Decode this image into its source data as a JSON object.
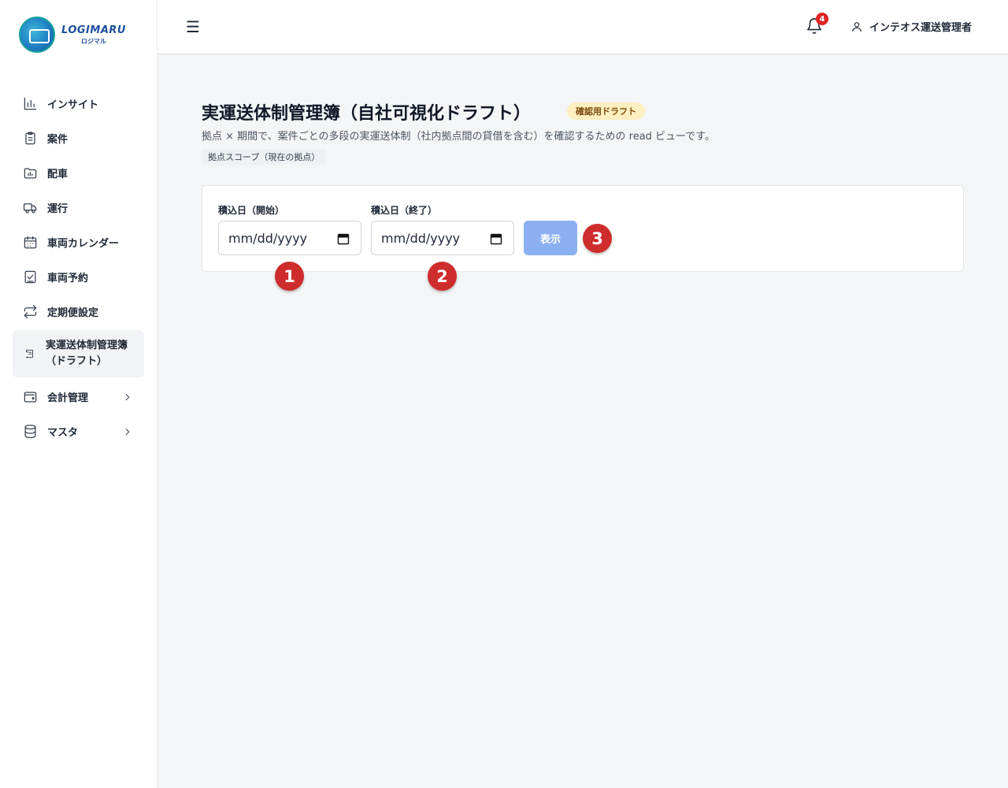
{
  "sidebar": {
    "logo": {
      "main": "LOGIMARU",
      "sub": "ロジマル"
    },
    "items": [
      {
        "label": "インサイト",
        "icon": "bar-chart-icon"
      },
      {
        "label": "案件",
        "icon": "clipboard-icon"
      },
      {
        "label": "配車",
        "icon": "folder-chart-icon"
      },
      {
        "label": "運行",
        "icon": "truck-icon"
      },
      {
        "label": "車両カレンダー",
        "icon": "calendar-icon"
      },
      {
        "label": "車両予約",
        "icon": "clipboard-check-icon"
      },
      {
        "label": "定期便設定",
        "icon": "repeat-icon"
      },
      {
        "label": "実運送体制管理簿\n（ドラフト）",
        "icon": "scroll-icon",
        "active": true
      },
      {
        "label": "会計管理",
        "icon": "wallet-icon",
        "expandable": true
      },
      {
        "label": "マスタ",
        "icon": "database-icon",
        "expandable": true
      }
    ]
  },
  "topbar": {
    "menu_icon": "☰",
    "notification_count": "4",
    "user_name": "インテオス運送管理者"
  },
  "page": {
    "title": "実運送体制管理簿（自社可視化ドラフト）",
    "badge": "確認用ドラフト",
    "description": "拠点 × 期間で、案件ごとの多段の実運送体制（社内拠点間の貸借を含む）を確認するための read ビューです。",
    "scope": "拠点スコープ（現在の拠点）"
  },
  "form": {
    "start_label": "積込日（開始）",
    "start_placeholder": "mm/dd/yyyy",
    "end_label": "積込日（終了）",
    "end_placeholder": "mm/dd/yyyy",
    "submit_label": "表示"
  },
  "markers": [
    "1",
    "2",
    "3"
  ],
  "colors": {
    "marker": "#cf2d2d",
    "button": "#8bb0f2",
    "badge_bg": "#fdefbf",
    "notification": "#e02424"
  }
}
